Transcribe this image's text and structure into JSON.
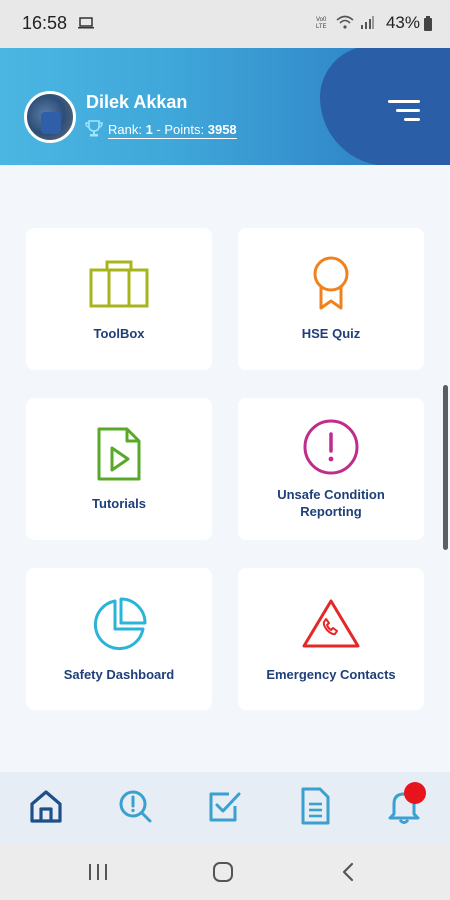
{
  "status_bar": {
    "time": "16:58",
    "battery_percent": "43%"
  },
  "header": {
    "user_name": "Dilek Akkan",
    "rank_prefix": "Rank: ",
    "rank_value": "1",
    "points_prefix": " - Points: ",
    "points_value": "3958",
    "gradient_start": "#4bb6e2",
    "gradient_end": "#2a78c0",
    "blob_color": "#2a5ea6"
  },
  "cards": [
    {
      "label": "ToolBox",
      "icon": "toolbox-icon",
      "color": "#a8b41e"
    },
    {
      "label": "HSE Quiz",
      "icon": "award-ribbon-icon",
      "color": "#f0821e"
    },
    {
      "label": "Tutorials",
      "icon": "video-file-icon",
      "color": "#5aa828"
    },
    {
      "label": "Unsafe Condition Reporting",
      "icon": "alert-circle-icon",
      "color": "#c02c8c"
    },
    {
      "label": "Safety Dashboard",
      "icon": "pie-chart-icon",
      "color": "#2ab4d8"
    },
    {
      "label": "Emergency Contacts",
      "icon": "emergency-phone-icon",
      "color": "#e42828"
    }
  ],
  "tab_bar": {
    "tabs": [
      "home-icon",
      "search-alert-icon",
      "checklist-icon",
      "document-icon",
      "bell-icon"
    ],
    "active_color": "#1f4f8a",
    "inactive_color": "#3aa0d0",
    "notification_color": "#e8141c"
  },
  "system_nav": [
    "recents-button",
    "home-button",
    "back-button"
  ]
}
